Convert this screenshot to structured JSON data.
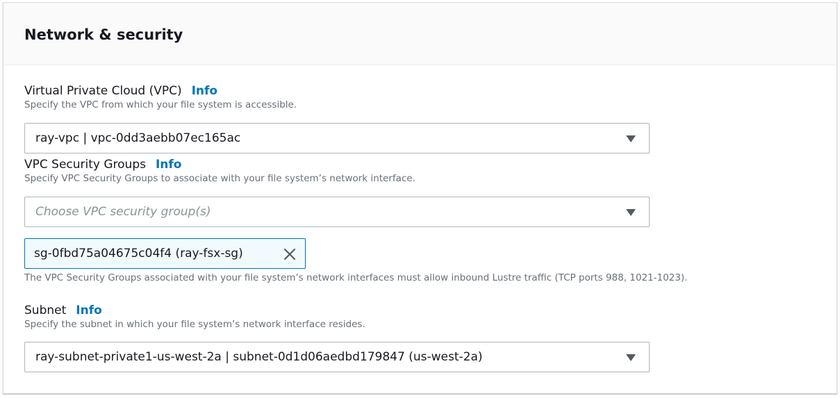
{
  "section": {
    "title": "Network & security"
  },
  "vpc": {
    "label": "Virtual Private Cloud (VPC)",
    "info": "Info",
    "description": "Specify the VPC from which your file system is accessible.",
    "value": "ray-vpc | vpc-0dd3aebb07ec165ac"
  },
  "security_groups": {
    "label": "VPC Security Groups",
    "info": "Info",
    "description": "Specify VPC Security Groups to associate with your file system’s network interface.",
    "placeholder": "Choose VPC security group(s)",
    "selected_tokens": [
      {
        "label": "sg-0fbd75a04675c04f4 (ray-fsx-sg)"
      }
    ],
    "constraint": "The VPC Security Groups associated with your file system’s network interfaces must allow inbound Lustre traffic (TCP ports 988, 1021-1023)."
  },
  "subnet": {
    "label": "Subnet",
    "info": "Info",
    "description": "Specify the subnet in which your file system’s network interface resides.",
    "value": "ray-subnet-private1-us-west-2a | subnet-0d1d06aedbd179847 (us-west-2a)"
  },
  "icons": {
    "dropdown": "caret-down-icon",
    "remove_token": "close-icon"
  },
  "colors": {
    "link": "#0073bb",
    "token_border": "#0073bb",
    "token_background": "#f1faff",
    "header_background": "#fafafa",
    "description_text": "#687078",
    "placeholder_text": "#879596"
  }
}
